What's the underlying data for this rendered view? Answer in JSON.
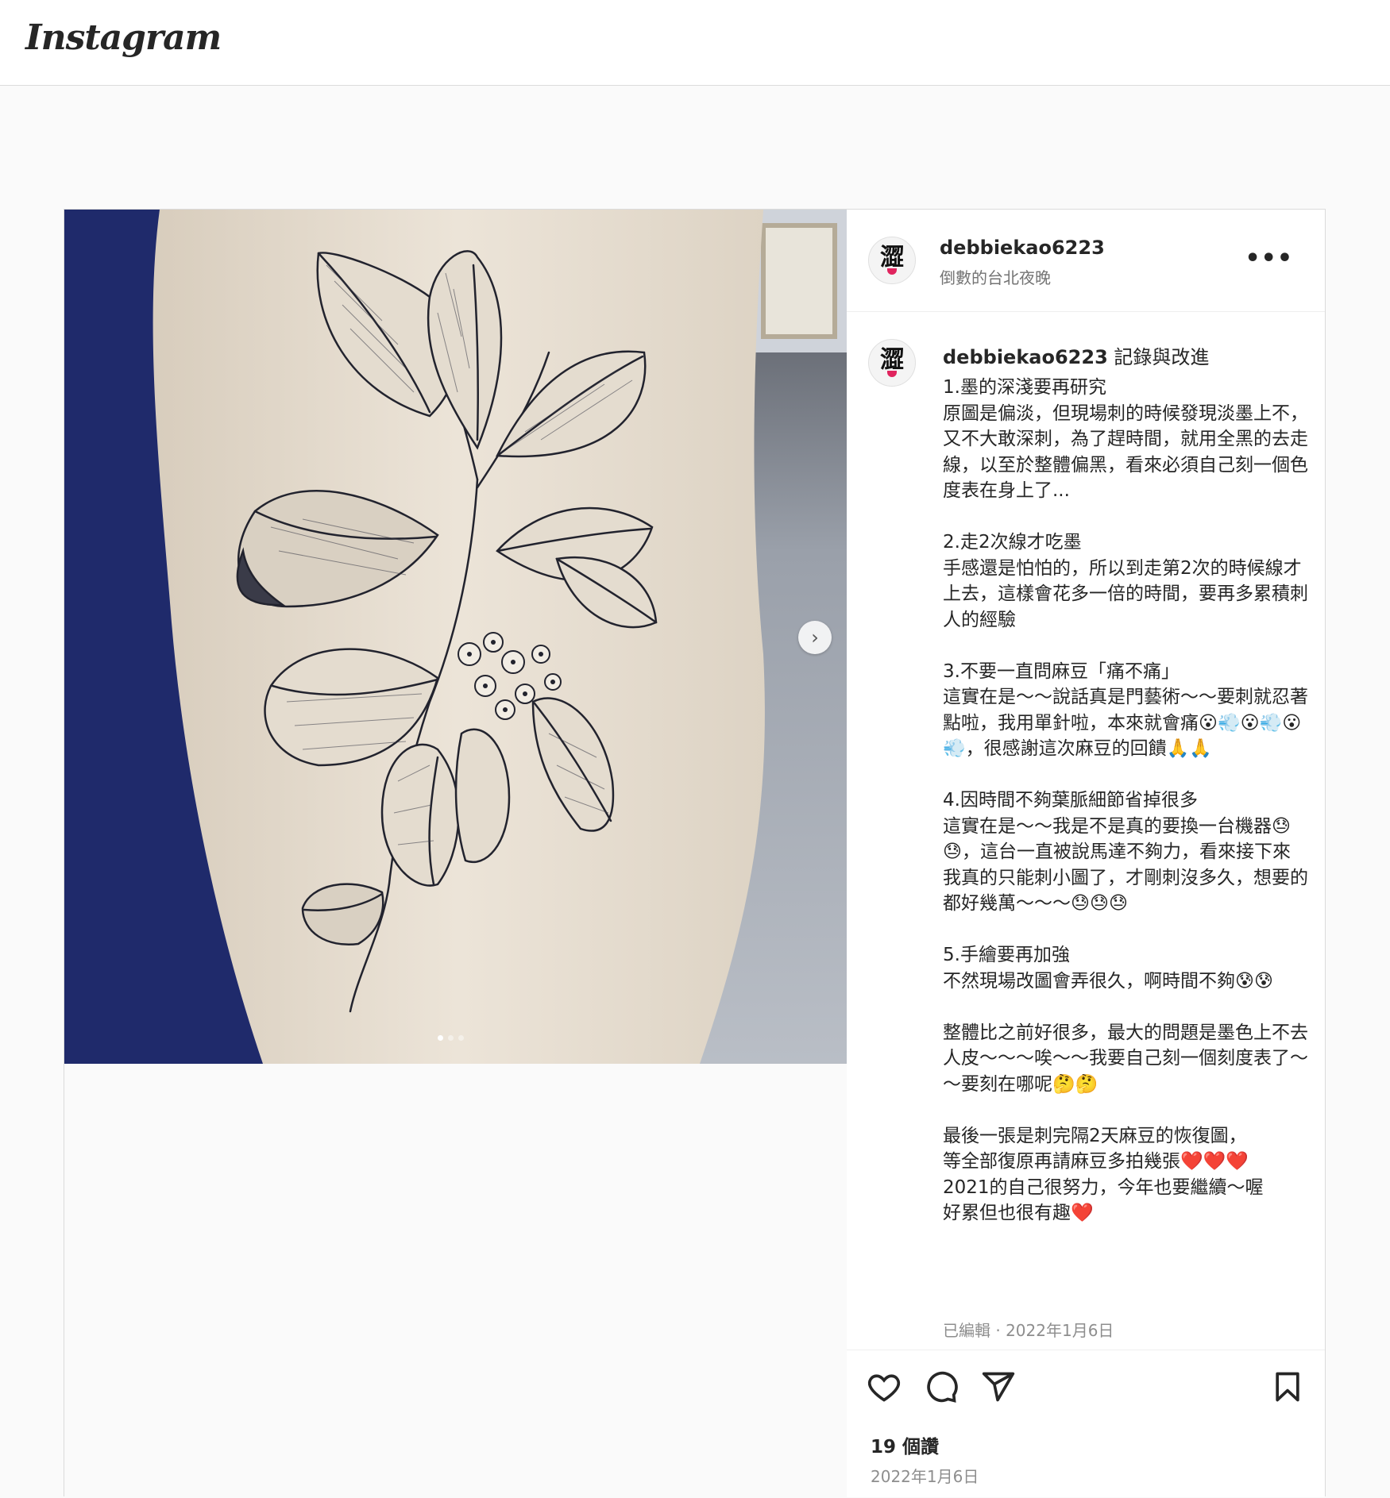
{
  "app": {
    "logo": "Instagram"
  },
  "post": {
    "username": "debbiekao6223",
    "location": "倒數的台北夜晚",
    "caption_title": "記錄與改進",
    "caption_body": "1.墨的深淺要再研究\n原圖是偏淡，但現場刺的時候發現淡墨上不，又不大敢深刺，為了趕時間，就用全黑的去走線，以至於整體偏黑，看來必須自己刻一個色度表在身上了...\n\n2.走2次線才吃墨\n手感還是怕怕的，所以到走第2次的時候線才上去，這樣會花多一倍的時間，要再多累積刺人的經驗\n\n3.不要一直問麻豆「痛不痛」\n這實在是～～說話真是門藝術～～要刺就忍著點啦，我用單針啦，本來就會痛😮💨😮💨😮💨，很感謝這次麻豆的回饋🙏🙏\n\n4.因時間不夠葉脈細節省掉很多\n這實在是～～我是不是真的要換一台機器😓😓，這台一直被說馬達不夠力，看來接下來我真的只能刺小圖了，才剛刺沒多久，想要的都好幾萬～～～😓😓😓\n\n5.手繪要再加強\n不然現場改圖會弄很久，啊時間不夠😰😰\n\n整體比之前好很多，最大的問題是墨色上不去人皮～～～唉～～我要自己刻一個刻度表了～～要刻在哪呢🤔🤔\n\n最後一張是刺完隔2天麻豆的恢復圖，\n等全部復原再請麻豆多拍幾張❤️❤️❤️\n2021的自己很努力，今年也要繼續～喔\n好累但也很有趣❤️",
    "edited_label": "已編輯 · 2022年1月6日",
    "likes": "19 個讚",
    "date": "2022年1月6日",
    "avatar_glyph": "澀",
    "carousel": {
      "current": 1,
      "total": 3
    }
  },
  "icons": {
    "more": "more-options-icon",
    "like": "heart-icon",
    "comment": "comment-icon",
    "share": "send-icon",
    "save": "bookmark-icon",
    "next": "chevron-right-icon"
  },
  "colors": {
    "media_background": "#1f2a6b",
    "skin": "#e6ddd0",
    "text": "#262626",
    "muted": "#8e8e8e"
  }
}
